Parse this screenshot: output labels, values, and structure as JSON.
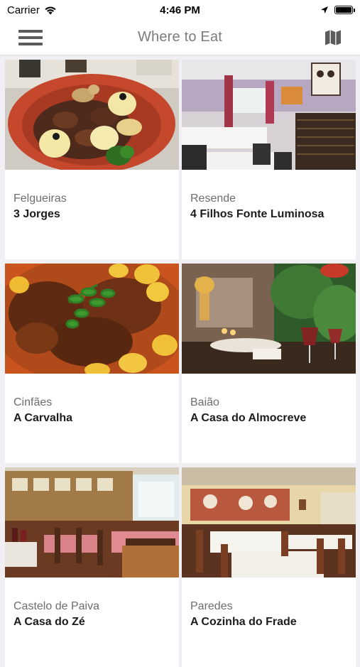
{
  "status_bar": {
    "carrier": "Carrier",
    "time": "4:46 PM"
  },
  "nav": {
    "title": "Where to Eat",
    "menu_icon": "hamburger-icon",
    "map_icon": "map-icon"
  },
  "restaurants": [
    {
      "location": "Felgueiras",
      "name": "3 Jorges"
    },
    {
      "location": "Resende",
      "name": "4 Filhos Fonte Luminosa"
    },
    {
      "location": "Cinfães",
      "name": "A Carvalha"
    },
    {
      "location": "Baião",
      "name": "A Casa do Almocreve"
    },
    {
      "location": "Castelo de Paiva",
      "name": "A Casa do Zé"
    },
    {
      "location": "Paredes",
      "name": "A Cozinha do Frade"
    }
  ]
}
